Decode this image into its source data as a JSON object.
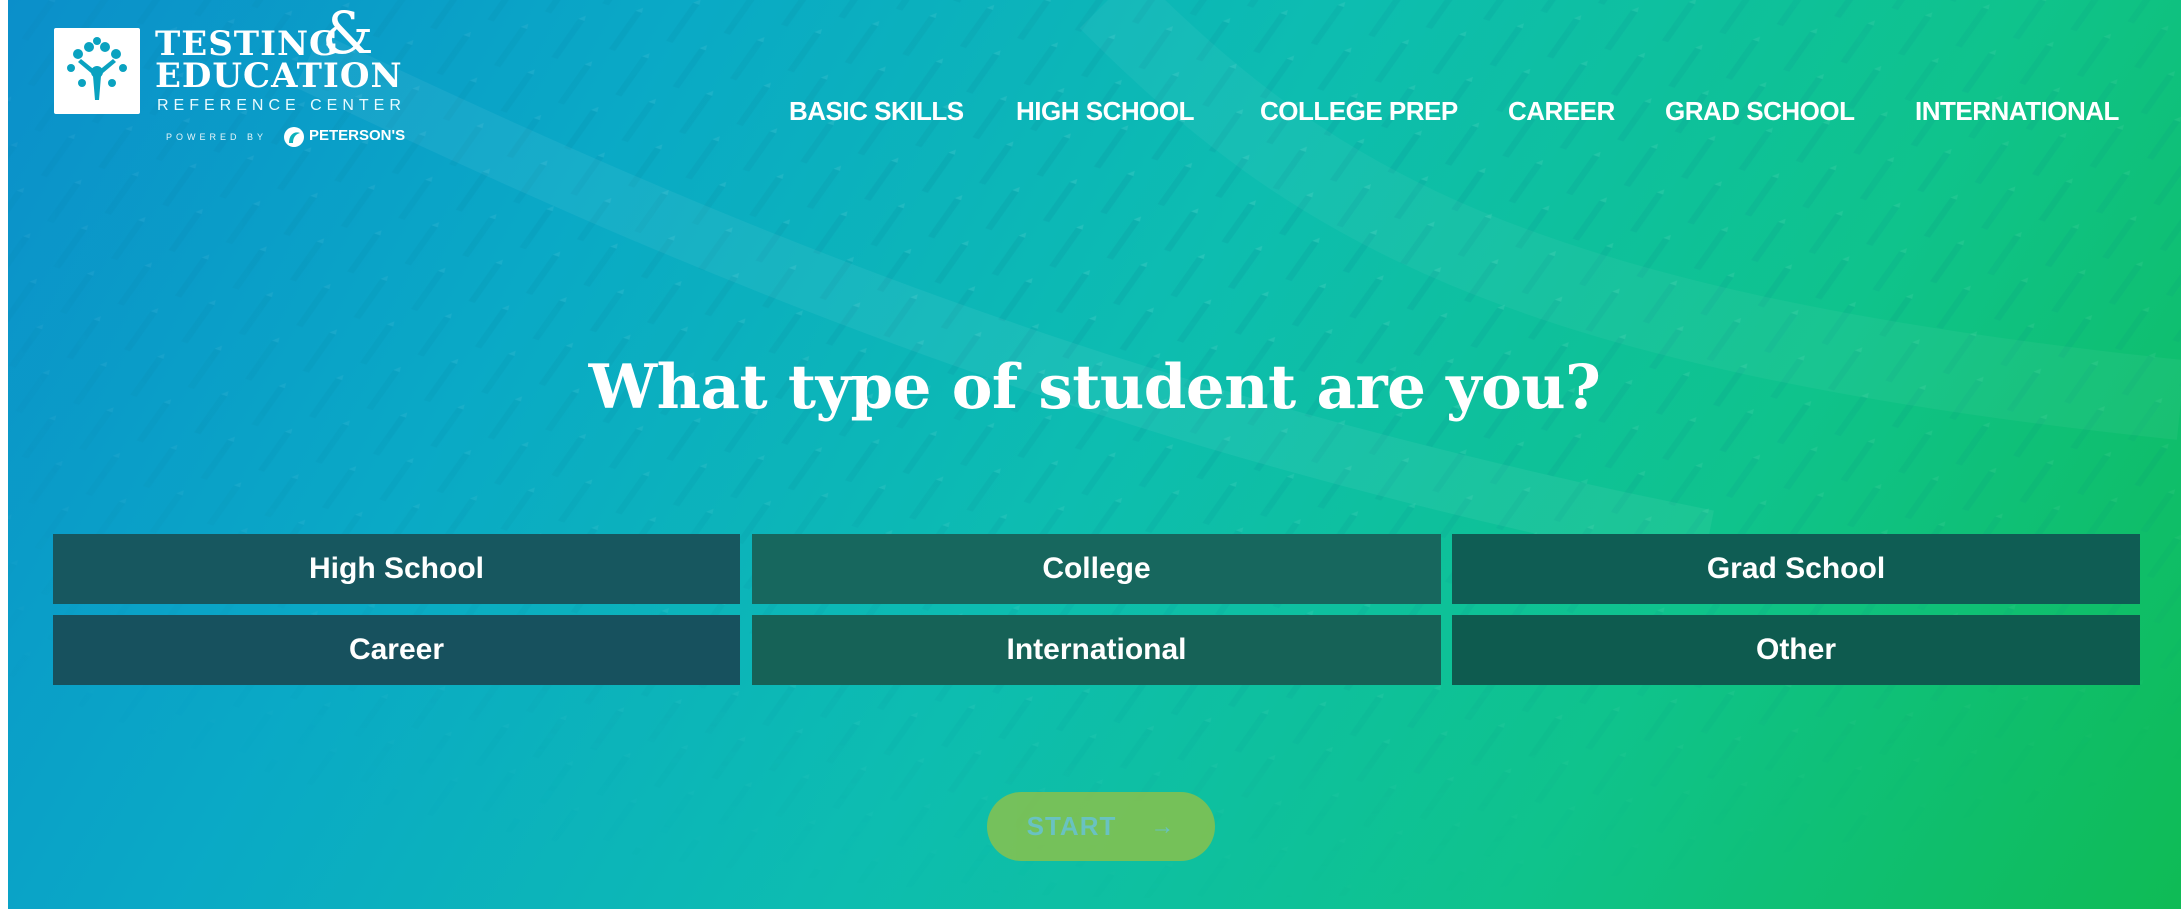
{
  "logo": {
    "title_line1": "TESTING",
    "ampersand": "&",
    "title_line2": "EDUCATION",
    "subtitle": "REFERENCE CENTER",
    "powered_by": "POWERED BY",
    "brand": "PETERSON'S",
    "icon": "tree-people-icon"
  },
  "nav": {
    "items": [
      {
        "label": "BASIC SKILLS"
      },
      {
        "label": "HIGH SCHOOL"
      },
      {
        "label": "COLLEGE PREP"
      },
      {
        "label": "CAREER"
      },
      {
        "label": "GRAD SCHOOL"
      },
      {
        "label": "INTERNATIONAL"
      }
    ]
  },
  "main": {
    "question": "What type of student are you?",
    "options": [
      {
        "label": "High School",
        "color": "#17575f"
      },
      {
        "label": "College",
        "color": "#17675e"
      },
      {
        "label": "Grad School",
        "color": "#0f5d54"
      },
      {
        "label": "Career",
        "color": "#17515e"
      },
      {
        "label": "International",
        "color": "#166257"
      },
      {
        "label": "Other",
        "color": "#0e5b4f"
      }
    ],
    "start_label": "START",
    "start_icon": "arrow-right-icon"
  },
  "colors": {
    "gradient_start": "#0b8fca",
    "gradient_end": "#0fbb55",
    "start_button": "#8cc24a"
  }
}
